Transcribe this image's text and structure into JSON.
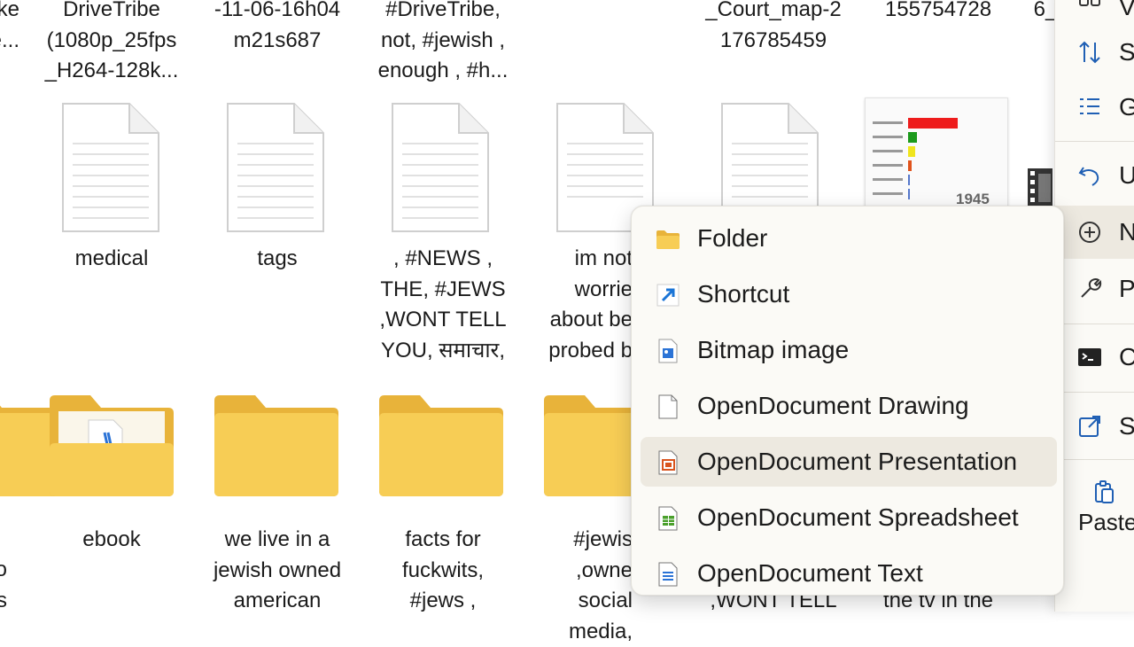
{
  "top_labels": [
    "ke\ne...",
    "DriveTribe\n(1080p_25fps\n_H264-128k...",
    "-11-06-16h04\nm21s687",
    "#DriveTribe,\nnot, #jewish ,\nenough , #h...",
    "_Court_map-2\n176785459",
    "155754728",
    "6_"
  ],
  "row2_labels": [
    "medical",
    "tags",
    ", #NEWS ,\nTHE, #JEWS\n,WONT TELL\nYOU, समाचार,",
    "im not\nworrie\nabout be\nprobed b"
  ],
  "thumb_year": "1945",
  "row3_labels": [
    "o\ns",
    "ebook",
    "we live in a\njewish owned\namerican",
    "facts for\nfuckwits,\n#jews ,",
    "#jewis\n,owne\nsocial media,",
    ",WONT TELL",
    "the tv in the"
  ],
  "new_menu": {
    "items": [
      {
        "label": "Folder",
        "icon": "folder-icon"
      },
      {
        "label": "Shortcut",
        "icon": "shortcut-icon"
      },
      {
        "label": "Bitmap image",
        "icon": "bitmap-icon"
      },
      {
        "label": "OpenDocument Drawing",
        "icon": "drawing-icon"
      },
      {
        "label": "OpenDocument Presentation",
        "icon": "presentation-icon"
      },
      {
        "label": "OpenDocument Spreadsheet",
        "icon": "spreadsheet-icon"
      },
      {
        "label": "OpenDocument Text",
        "icon": "text-doc-icon"
      }
    ],
    "highlighted": "OpenDocument Presentation"
  },
  "side_menu": {
    "items": [
      "V",
      "S",
      "G",
      "U",
      "N",
      "P",
      "C",
      "S"
    ],
    "paste": "Paste"
  },
  "colors": {
    "folder": "#f5c94c",
    "accent": "#0a64c8",
    "menu_bg": "#fbfaf6",
    "hover_bg": "#ede9e0"
  }
}
